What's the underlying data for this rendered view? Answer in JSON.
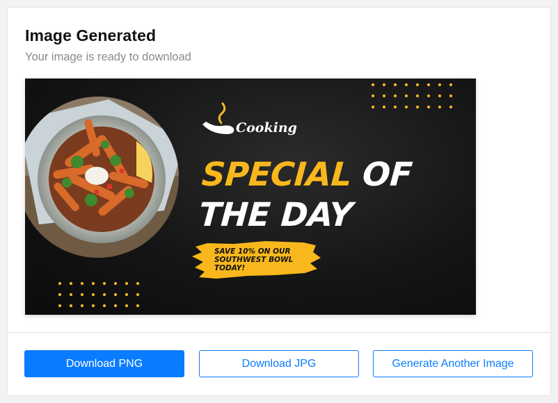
{
  "header": {
    "title": "Image Generated",
    "subtitle": "Your image is ready to download"
  },
  "banner": {
    "logo_text": "Cooking",
    "headline_line1_yellow": "SPECIAL",
    "headline_line1_white": " OF",
    "headline_line2": "THE DAY",
    "promo_text": "SAVE 10% ON OUR SOUTHWEST BOWL TODAY!",
    "colors": {
      "background": "#111111",
      "accent": "#f8b81d",
      "text": "#ffffff"
    }
  },
  "actions": {
    "download_png": "Download PNG",
    "download_jpg": "Download JPG",
    "generate_another": "Generate Another Image"
  },
  "colors": {
    "primary": "#0a7cff",
    "muted_text": "#8a8a8e"
  }
}
